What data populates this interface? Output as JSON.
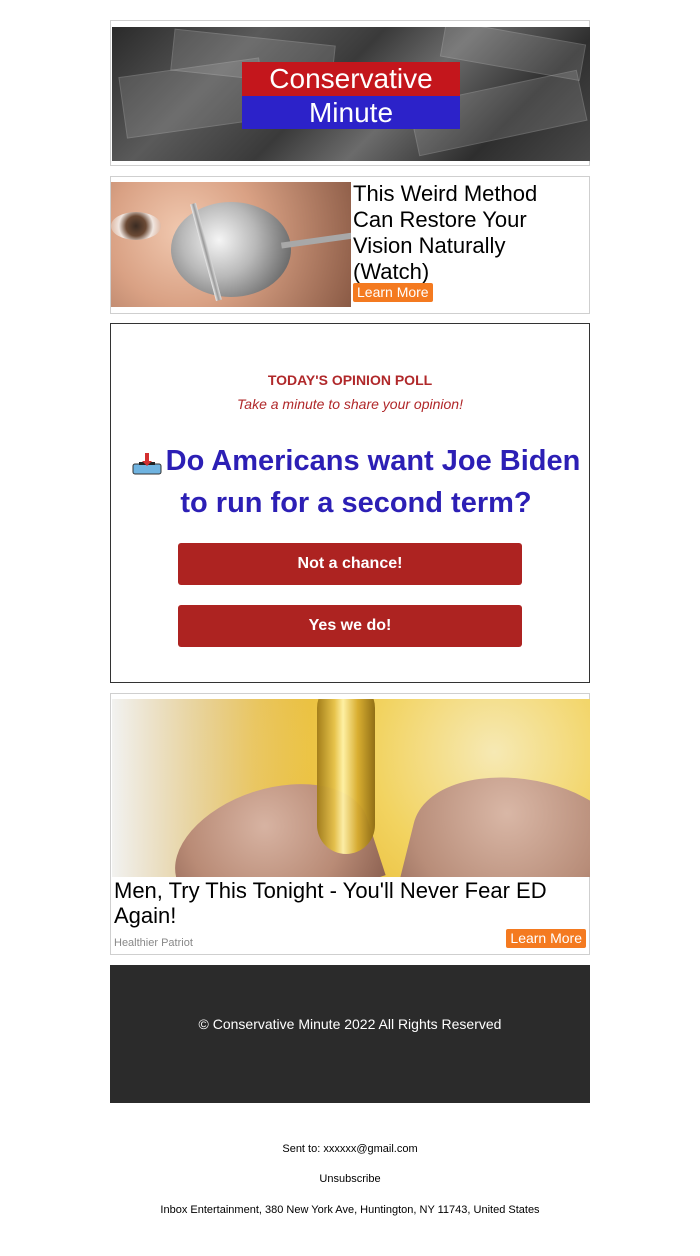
{
  "header": {
    "logo_line1": "Conservative",
    "logo_line2": "Minute",
    "colors": {
      "logo_red": "#c4161c",
      "logo_blue": "#2c22c9"
    }
  },
  "ad1": {
    "headline": "This Weird Method Can Restore Your Vision Naturally (Watch)",
    "sponsor_partial": "ed",
    "learn_more": "Learn More"
  },
  "poll": {
    "kicker": "TODAY'S OPINION POLL",
    "subtitle": "Take a minute to share your opinion!",
    "question": "Do Americans want Joe Biden to run for a second term?",
    "ballot_icon": "ballot-box-icon",
    "option1": "Not a chance!",
    "option2": "Yes we do!",
    "colors": {
      "accent": "#b0282a",
      "question": "#2c1fb5",
      "button": "#ad2321"
    }
  },
  "ad2": {
    "headline": "Men, Try This Tonight - You'll Never Fear ED Again!",
    "brand": "Healthier Patriot",
    "learn_more": "Learn More"
  },
  "footer": {
    "copyright": "© Conservative Minute 2022 All Rights Reserved"
  },
  "meta": {
    "sent_to": "Sent to: xxxxxx@gmail.com",
    "unsubscribe": "Unsubscribe",
    "address": "Inbox Entertainment, 380 New York Ave, Huntington, NY 11743, United States"
  }
}
